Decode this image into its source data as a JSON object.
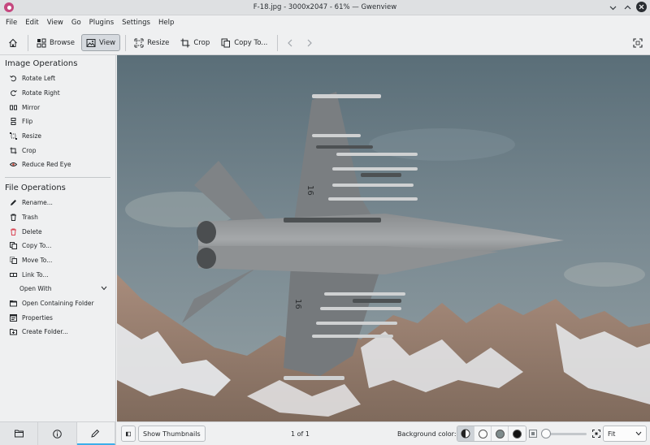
{
  "window": {
    "title": "F-18.jpg - 3000x2047 - 61% — Gwenview",
    "buttons": [
      "chevron-down-icon",
      "chevron-up-icon",
      "close-icon"
    ]
  },
  "menubar": {
    "items": [
      "File",
      "Edit",
      "View",
      "Go",
      "Plugins",
      "Settings",
      "Help"
    ]
  },
  "toolbar": {
    "browse": "Browse",
    "view": "View",
    "resize": "Resize",
    "crop": "Crop",
    "copy_to": "Copy To..."
  },
  "sidebar": {
    "image_ops_title": "Image Operations",
    "image_ops": [
      {
        "label": "Rotate Left",
        "icon": "rotate-left-icon"
      },
      {
        "label": "Rotate Right",
        "icon": "rotate-right-icon"
      },
      {
        "label": "Mirror",
        "icon": "mirror-icon"
      },
      {
        "label": "Flip",
        "icon": "flip-icon"
      },
      {
        "label": "Resize",
        "icon": "resize-icon"
      },
      {
        "label": "Crop",
        "icon": "crop-icon"
      },
      {
        "label": "Reduce Red Eye",
        "icon": "eye-icon"
      }
    ],
    "file_ops_title": "File Operations",
    "file_ops": [
      {
        "label": "Rename...",
        "icon": "pencil-icon"
      },
      {
        "label": "Trash",
        "icon": "trash-icon"
      },
      {
        "label": "Delete",
        "icon": "delete-icon"
      },
      {
        "label": "Copy To...",
        "icon": "copy-icon"
      },
      {
        "label": "Move To...",
        "icon": "move-icon"
      },
      {
        "label": "Link To...",
        "icon": "link-icon"
      }
    ],
    "open_with": "Open With",
    "file_ops_more": [
      {
        "label": "Open Containing Folder",
        "icon": "folder-open-icon"
      },
      {
        "label": "Properties",
        "icon": "properties-icon"
      },
      {
        "label": "Create Folder...",
        "icon": "folder-new-icon"
      }
    ]
  },
  "statusbar": {
    "show_thumbnails": "Show Thumbnails",
    "page_count": "1 of 1",
    "background_label": "Background color:",
    "zoom_value": "Fit"
  }
}
